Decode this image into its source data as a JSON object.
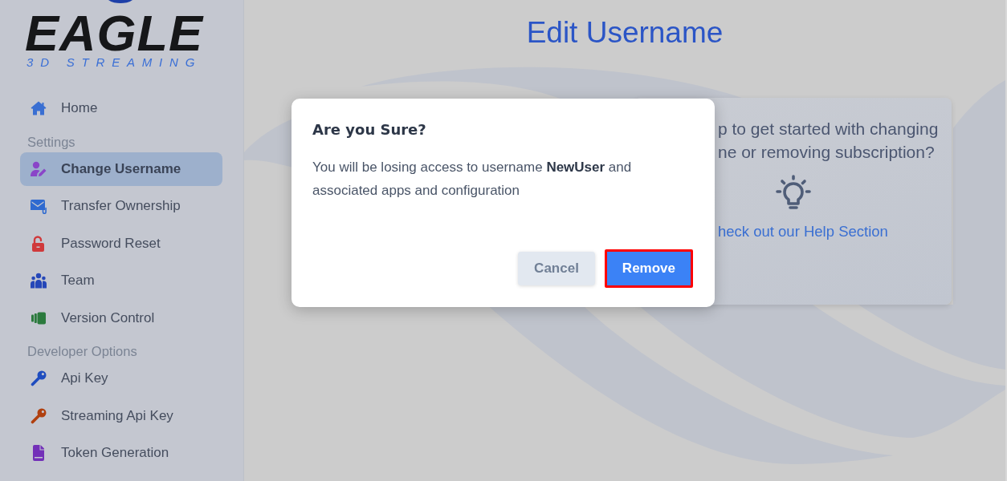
{
  "sidebar": {
    "logo": {
      "title": "EAGLE",
      "subtitle": "3D STREAMING"
    },
    "sections": [
      {
        "items": [
          {
            "label": "Home",
            "selected": false,
            "color": "#3a6fd2"
          }
        ]
      },
      {
        "heading": "Settings",
        "items": [
          {
            "label": "Change Username",
            "selected": true,
            "color": "#8a45c8"
          },
          {
            "label": "Transfer Ownership",
            "selected": false,
            "color": "#2f6ad0"
          },
          {
            "label": "Password Reset",
            "selected": false,
            "color": "#d0393b"
          },
          {
            "label": "Team",
            "selected": false,
            "color": "#2547b8"
          },
          {
            "label": "Version Control",
            "selected": false,
            "color": "#2b7a3d"
          }
        ]
      },
      {
        "heading": "Developer Options",
        "items": [
          {
            "label": "Api Key",
            "selected": false,
            "color": "#1f4dbf"
          },
          {
            "label": "Streaming Api Key",
            "selected": false,
            "color": "#b0400f"
          },
          {
            "label": "Token Generation",
            "selected": false,
            "color": "#7330b8"
          }
        ]
      }
    ]
  },
  "main": {
    "title": "Edit Username",
    "help_card": {
      "lines": [
        "p to get started with changing",
        "ne or removing subscription?"
      ],
      "link": "heck out our Help Section"
    }
  },
  "dialog": {
    "title": "Are you Sure?",
    "message": "You will be losing access to username **NewUser** and associated apps and configuration",
    "buttons": [
      {
        "label": "Cancel",
        "kind": "secondary",
        "highlighted": false
      },
      {
        "label": "Remove",
        "kind": "primary",
        "highlighted": true
      }
    ]
  }
}
